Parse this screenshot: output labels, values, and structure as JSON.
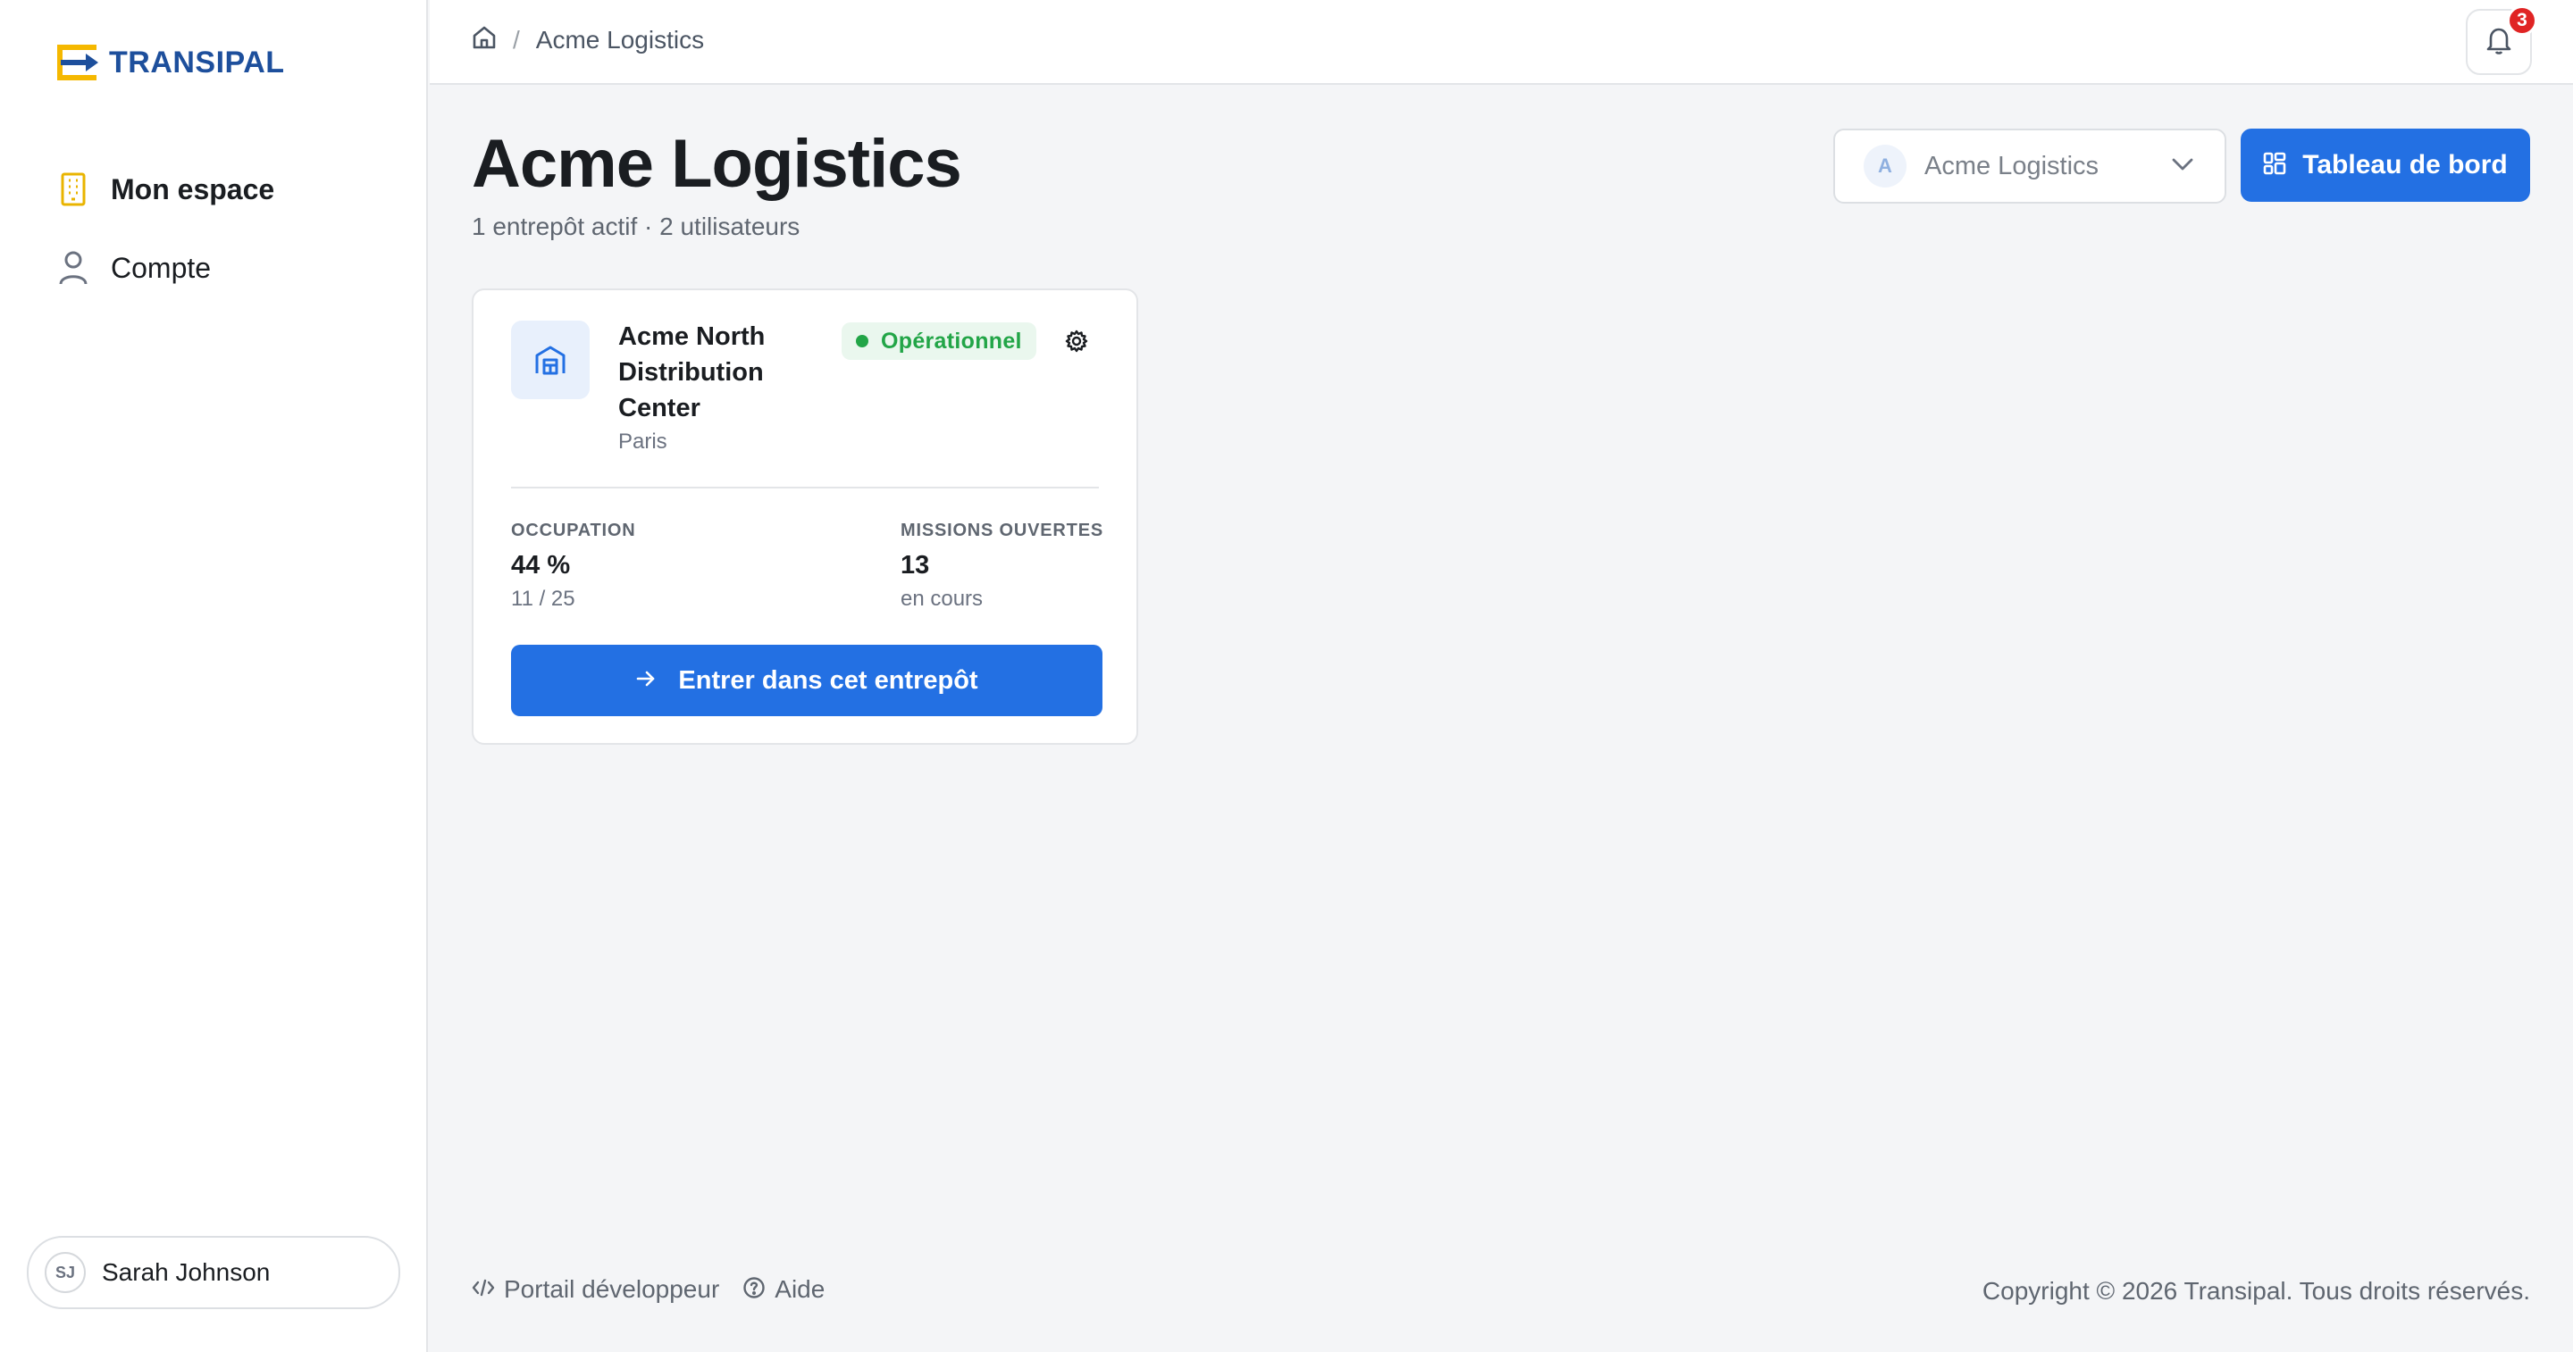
{
  "brand": {
    "name": "TRANSIPAL",
    "colors": {
      "blue": "#1d4f9c",
      "yellow": "#f5b800",
      "accent": "#2370e3"
    }
  },
  "sidebar": {
    "items": [
      {
        "label": "Mon espace",
        "icon": "building-icon",
        "active": true
      },
      {
        "label": "Compte",
        "icon": "user-icon",
        "active": false
      }
    ],
    "user": {
      "initials": "SJ",
      "name": "Sarah Johnson"
    }
  },
  "topbar": {
    "breadcrumb": {
      "separator": "/",
      "current": "Acme Logistics"
    },
    "notifications": {
      "count": "3"
    }
  },
  "header": {
    "title": "Acme Logistics",
    "subtitle": "1 entrepôt actif · 2 utilisateurs",
    "org_select": {
      "initial": "A",
      "value": "Acme Logistics"
    },
    "dashboard_button": "Tableau de bord"
  },
  "warehouse": {
    "name": "Acme North Distribution Center",
    "city": "Paris",
    "status": "Opérationnel",
    "occupation": {
      "label": "OCCUPATION",
      "value": "44 %",
      "detail": "11 / 25"
    },
    "missions": {
      "label": "MISSIONS OUVERTES",
      "value": "13",
      "detail": "en cours"
    },
    "enter_button": "Entrer dans cet entrepôt"
  },
  "footer": {
    "developer_portal": "Portail développeur",
    "help": "Aide",
    "copyright": "Copyright © 2026 Transipal. Tous droits réservés."
  }
}
